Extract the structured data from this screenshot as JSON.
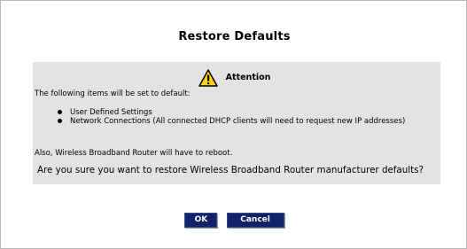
{
  "dialog": {
    "title": "Restore Defaults",
    "attention_label": "Attention",
    "intro": "The following items will be set to default:",
    "items": [
      {
        "label": "User Defined Settings"
      },
      {
        "label": "Network Connections (All connected DHCP clients will need to request new IP addresses)"
      }
    ],
    "reboot_note": "Also, Wireless Broadband Router will have to reboot.",
    "question": "Are you sure you want to restore Wireless Broadband Router manufacturer defaults?",
    "ok_label": "OK",
    "cancel_label": "Cancel",
    "icons": {
      "attention": "warning-triangle-icon"
    },
    "colors": {
      "panel_bg": "#e3e3e3",
      "button_bg": "#112266",
      "button_text": "#ffffff",
      "warning_yellow": "#ffd21a"
    }
  }
}
